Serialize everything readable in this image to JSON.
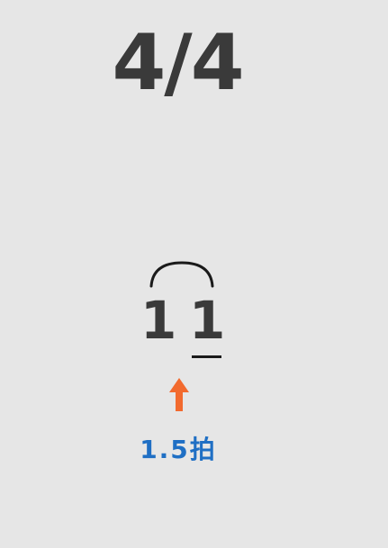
{
  "time_signature": "4/4",
  "notes": [
    {
      "text": "1"
    },
    {
      "text": "1"
    }
  ],
  "beat_label": "1.5拍",
  "colors": {
    "background": "#e6e6e6",
    "text": "#3a3a3a",
    "arrow": "#f26a2e",
    "label": "#1f6fc4"
  },
  "icons": {
    "tie": "tie-arc-icon",
    "arrow": "up-arrow-icon"
  }
}
